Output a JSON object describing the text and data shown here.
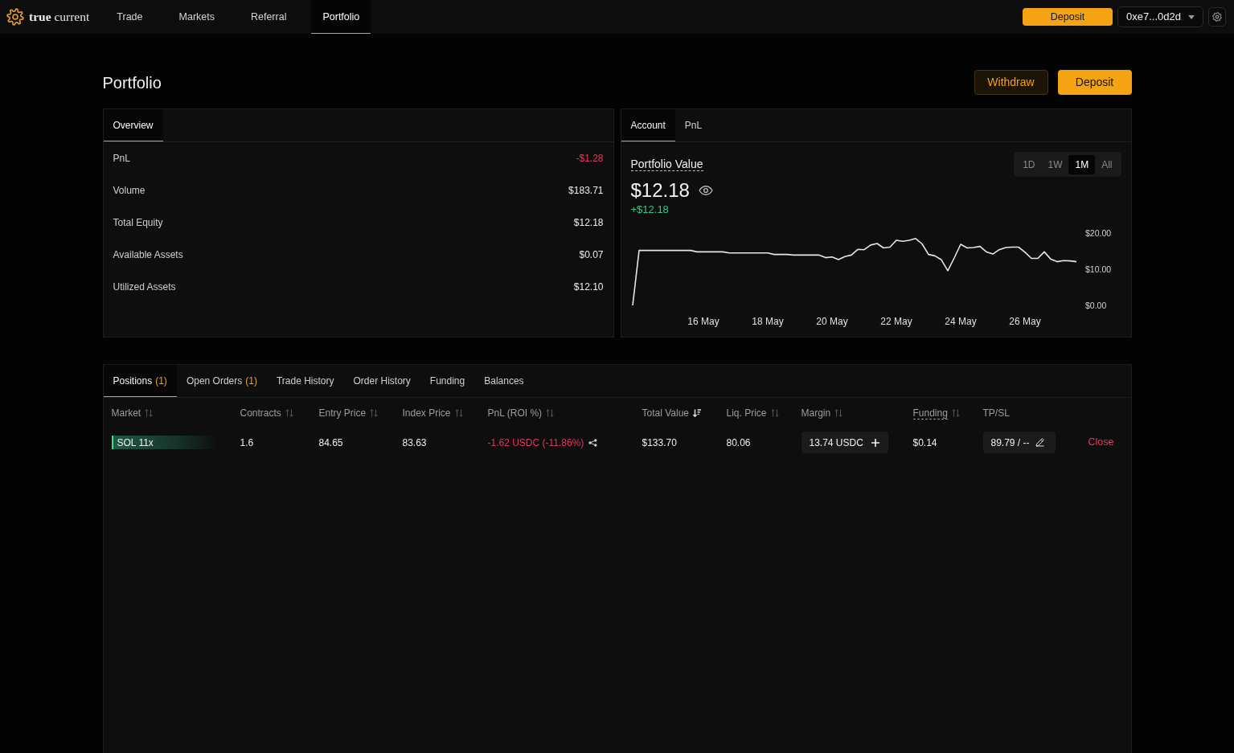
{
  "nav": {
    "logo": "**true** current",
    "items": [
      {
        "label": "Trade",
        "selected": false
      },
      {
        "label": "Markets",
        "selected": false
      },
      {
        "label": "Referral",
        "selected": false
      },
      {
        "label": "Portfolio",
        "selected": true
      }
    ],
    "deposit": "Deposit",
    "wallet": "0xe7...0d2d"
  },
  "header": {
    "title": "Portfolio",
    "buttons": [
      {
        "label": "Withdraw",
        "kind": "secondary"
      },
      {
        "label": "Deposit",
        "kind": "primary"
      }
    ]
  },
  "overview": {
    "tabs": [
      {
        "label": "Overview",
        "selected": true
      }
    ],
    "rows": [
      {
        "label": "PnL",
        "value": "-$1.28",
        "negative": true
      },
      {
        "label": "Volume",
        "value": "$183.71",
        "negative": false
      },
      {
        "label": "Total Equity",
        "value": "$12.18",
        "negative": false
      },
      {
        "label": "Available Assets",
        "value": "$0.07",
        "negative": false
      },
      {
        "label": "Utilized Assets",
        "value": "$12.10",
        "negative": false
      }
    ]
  },
  "account": {
    "tabs": [
      {
        "label": "Account",
        "selected": true
      },
      {
        "label": "PnL",
        "selected": false
      }
    ],
    "title": "Portfolio Value",
    "timeframes": [
      {
        "label": "1D",
        "selected": false
      },
      {
        "label": "1W",
        "selected": false
      },
      {
        "label": "1M",
        "selected": true
      },
      {
        "label": "All",
        "selected": false
      }
    ],
    "value": "$12.18",
    "change": {
      "text": "+$12.18",
      "positive": true
    },
    "chart_data": {
      "type": "line",
      "categories": [
        null,
        null,
        null,
        null,
        null,
        null,
        null,
        null,
        null,
        null,
        null,
        "16 May",
        null,
        null,
        null,
        null,
        null,
        null,
        null,
        null,
        null,
        "18 May",
        null,
        null,
        null,
        null,
        null,
        null,
        null,
        null,
        null,
        "20 May",
        null,
        null,
        null,
        null,
        null,
        null,
        null,
        null,
        null,
        "22 May",
        null,
        null,
        null,
        null,
        null,
        null,
        null,
        null,
        null,
        "24 May",
        null,
        null,
        null,
        null,
        null,
        null,
        null,
        null,
        null,
        "26 May",
        null,
        null,
        null,
        null,
        null,
        null,
        null,
        null
      ],
      "series": [
        {
          "color": "#e6e6e6",
          "values": [
            0,
            15.2,
            15.2,
            15.2,
            15.2,
            15.2,
            15.2,
            15.2,
            15.2,
            15.2,
            14.8,
            14.8,
            14.8,
            14.8,
            14.8,
            14.5,
            14.5,
            14.5,
            14.5,
            14.5,
            14.5,
            14.5,
            14.1,
            14.1,
            14.1,
            13.9,
            13.9,
            13.9,
            13.9,
            13.9,
            13.2,
            13.4,
            12.7,
            13.5,
            13.9,
            15.5,
            15.4,
            16.7,
            17.1,
            15.9,
            16.1,
            18.0,
            17.7,
            18.0,
            18.5,
            17.0,
            14.1,
            13.7,
            12.6,
            9.6,
            13.1,
            16.9,
            15.9,
            16.0,
            16.3,
            14.8,
            14.2,
            15.4,
            16.0,
            16.1,
            16.1,
            14.7,
            13.0,
            13.0,
            14.8,
            12.8,
            12.1,
            12.4,
            12.3,
            12.1
          ]
        }
      ],
      "ylim": [
        0,
        20
      ],
      "yticks": [
        {
          "value": 0,
          "label": "$0.00"
        },
        {
          "value": 10,
          "label": "$10.00"
        },
        {
          "value": 20,
          "label": "$20.00"
        }
      ]
    }
  },
  "positions": {
    "tabs": [
      {
        "label": "Positions",
        "count": "(1)",
        "selected": true
      },
      {
        "label": "Open Orders",
        "count": "(1)",
        "selected": false
      },
      {
        "label": "Trade History",
        "selected": false
      },
      {
        "label": "Order History",
        "selected": false
      },
      {
        "label": "Funding",
        "selected": false
      },
      {
        "label": "Balances",
        "selected": false
      }
    ],
    "columns": [
      {
        "label": "Market",
        "sortable": true,
        "sorted": false,
        "has_tooltip": false
      },
      {
        "label": "Contracts",
        "sortable": true,
        "sorted": false,
        "has_tooltip": false
      },
      {
        "label": "Entry Price",
        "sortable": true,
        "sorted": false,
        "has_tooltip": false
      },
      {
        "label": "Index Price",
        "sortable": true,
        "sorted": false,
        "has_tooltip": false
      },
      {
        "label": "PnL (ROI %)",
        "sortable": true,
        "sorted": false,
        "has_tooltip": false
      },
      {
        "label": "Total Value",
        "sortable": true,
        "sorted": true,
        "has_tooltip": false
      },
      {
        "label": "Liq. Price",
        "sortable": true,
        "sorted": false,
        "has_tooltip": false
      },
      {
        "label": "Margin",
        "sortable": true,
        "sorted": false,
        "has_tooltip": false
      },
      {
        "label": "Funding",
        "sortable": true,
        "sorted": false,
        "has_tooltip": true
      },
      {
        "label": "TP/SL",
        "sortable": false,
        "sorted": false,
        "has_tooltip": false
      }
    ],
    "rows": [
      {
        "market": "SOL 11x",
        "long": true,
        "contracts": "1.6",
        "entry_price": "84.65",
        "index_price": "83.63",
        "pnl": {
          "text": "-1.62 USDC (-11.86%)",
          "negative": true
        },
        "total_value": "$133.70",
        "liq_price": "80.06",
        "margin": "13.74 USDC",
        "funding": "$0.14",
        "tp_sl": "89.79 / --",
        "action": "Close"
      }
    ]
  }
}
